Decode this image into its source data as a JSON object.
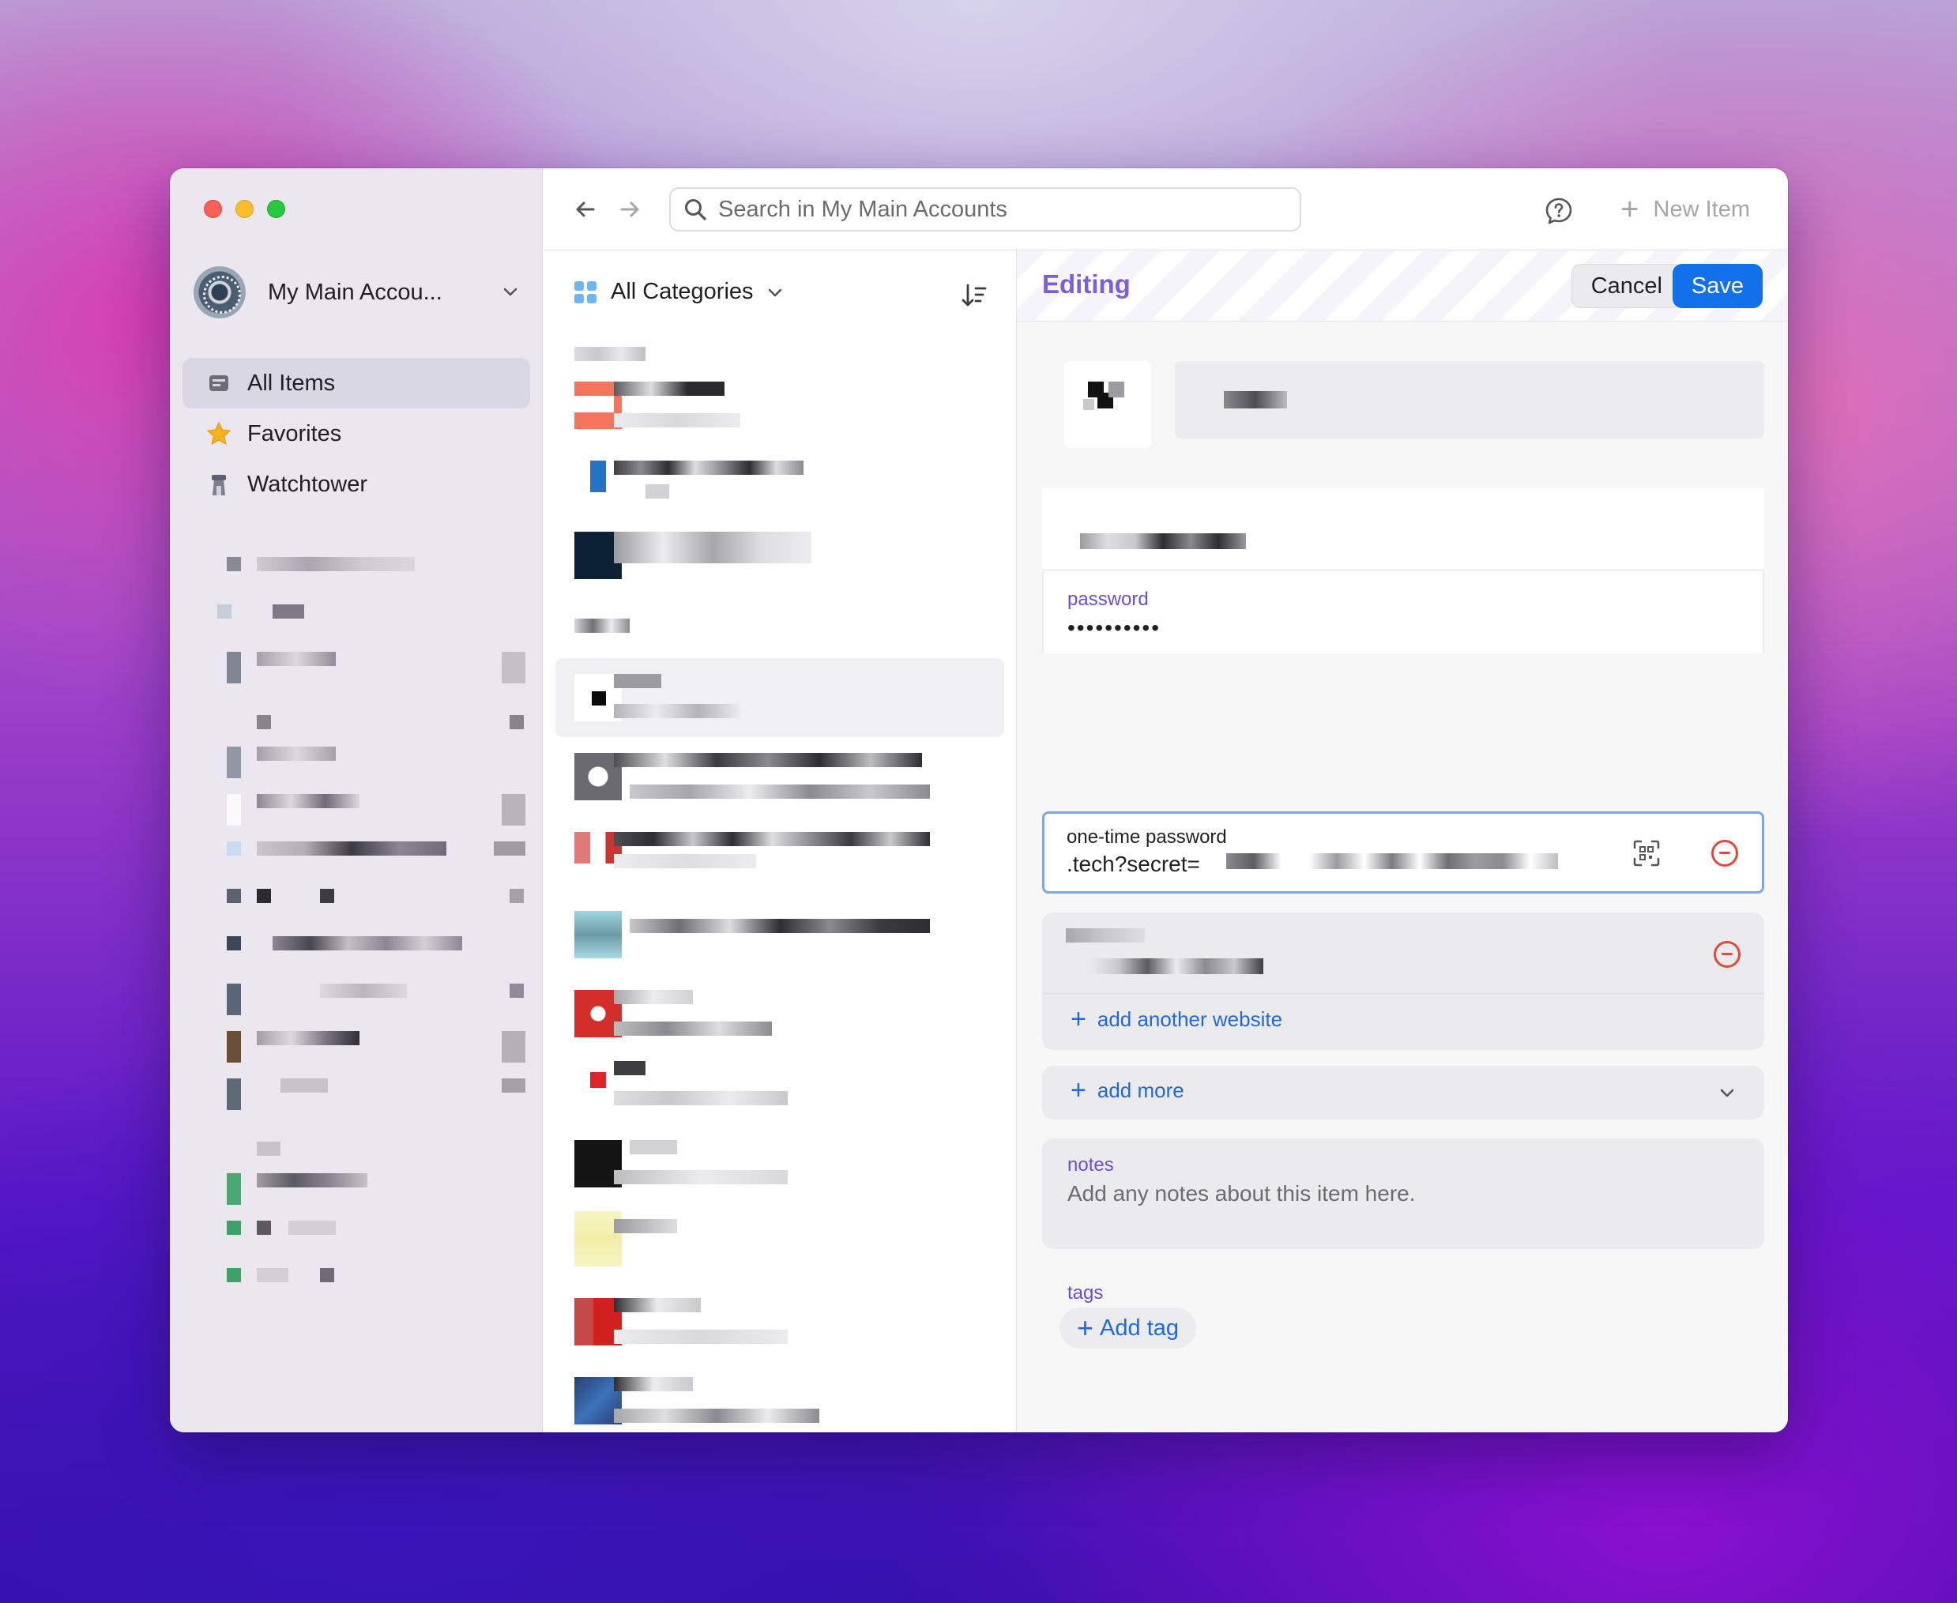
{
  "sidebar": {
    "account_name": "My Main Accou...",
    "items": [
      {
        "label": "All Items",
        "icon": "all-items-icon",
        "active": true
      },
      {
        "label": "Favorites",
        "icon": "star-icon",
        "active": false
      },
      {
        "label": "Watchtower",
        "icon": "watchtower-icon",
        "active": false
      }
    ]
  },
  "toolbar": {
    "search_placeholder": "Search in My Main Accounts",
    "new_item_label": "New Item"
  },
  "list": {
    "category_label": "All Categories"
  },
  "editor": {
    "title": "Editing",
    "cancel_label": "Cancel",
    "save_label": "Save",
    "password": {
      "label": "password",
      "value": "••••••••••"
    },
    "otp": {
      "label": "one-time password",
      "value": ".tech?secret="
    },
    "add_website_label": "add another website",
    "add_more_label": "add more",
    "notes": {
      "label": "notes",
      "placeholder": "Add any notes about this item here."
    },
    "tags": {
      "label": "tags",
      "add_label": "Add tag"
    }
  },
  "colors": {
    "accent_purple": "#7b5fd6",
    "save_blue": "#1270ea",
    "link_blue": "#1f6ad6",
    "remove_red": "#e2483c"
  }
}
